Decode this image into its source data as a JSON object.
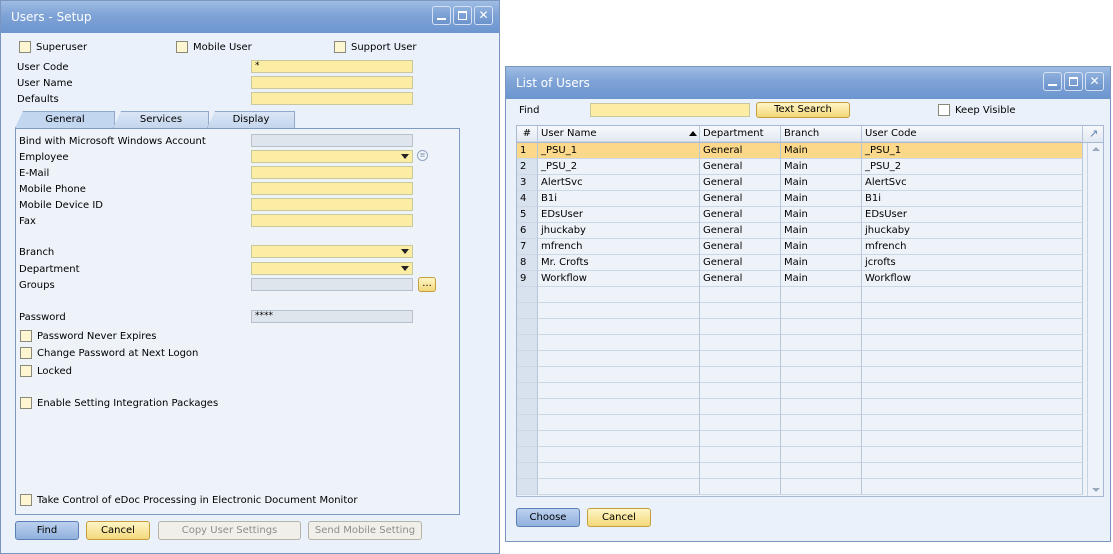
{
  "users_setup": {
    "title": "Users - Setup",
    "checkboxes": {
      "superuser": "Superuser",
      "mobile_user": "Mobile User",
      "support_user": "Support User"
    },
    "labels": {
      "user_code": "User Code",
      "user_name": "User Name",
      "defaults": "Defaults"
    },
    "values": {
      "user_code": "*",
      "password": "****"
    },
    "tabs": [
      "General",
      "Services",
      "Display"
    ],
    "general": {
      "bind_ms": "Bind with Microsoft Windows Account",
      "employee": "Employee",
      "email": "E-Mail",
      "mobile_phone": "Mobile Phone",
      "mobile_device_id": "Mobile Device ID",
      "fax": "Fax",
      "branch": "Branch",
      "department": "Department",
      "groups": "Groups",
      "groups_button": "...",
      "password": "Password",
      "pwd_never_expires": "Password Never Expires",
      "change_pwd_next_logon": "Change Password at Next Logon",
      "locked": "Locked",
      "enable_integration": "Enable Setting Integration Packages",
      "take_control_edoc": "Take Control of eDoc Processing in Electronic Document Monitor"
    },
    "buttons": {
      "find": "Find",
      "cancel": "Cancel",
      "copy_settings": "Copy User Settings",
      "send_mobile": "Send Mobile Setting"
    }
  },
  "list_of_users": {
    "title": "List of Users",
    "find_label": "Find",
    "text_search": "Text Search",
    "keep_visible": "Keep Visible",
    "columns": [
      "#",
      "User Name",
      "Department",
      "Branch",
      "User Code"
    ],
    "rows": [
      {
        "n": "1",
        "name": "_PSU_1",
        "dept": "General",
        "branch": "Main",
        "code": "_PSU_1"
      },
      {
        "n": "2",
        "name": "_PSU_2",
        "dept": "General",
        "branch": "Main",
        "code": "_PSU_2"
      },
      {
        "n": "3",
        "name": "AlertSvc",
        "dept": "General",
        "branch": "Main",
        "code": "AlertSvc"
      },
      {
        "n": "4",
        "name": "B1i",
        "dept": "General",
        "branch": "Main",
        "code": "B1i"
      },
      {
        "n": "5",
        "name": "EDsUser",
        "dept": "General",
        "branch": "Main",
        "code": "EDsUser"
      },
      {
        "n": "6",
        "name": "jhuckaby",
        "dept": "General",
        "branch": "Main",
        "code": "jhuckaby"
      },
      {
        "n": "7",
        "name": "mfrench",
        "dept": "General",
        "branch": "Main",
        "code": "mfrench"
      },
      {
        "n": "8",
        "name": "Mr. Crofts",
        "dept": "General",
        "branch": "Main",
        "code": "jcrofts"
      },
      {
        "n": "9",
        "name": "Workflow",
        "dept": "General",
        "branch": "Main",
        "code": "Workflow"
      }
    ],
    "buttons": {
      "choose": "Choose",
      "cancel": "Cancel"
    }
  }
}
